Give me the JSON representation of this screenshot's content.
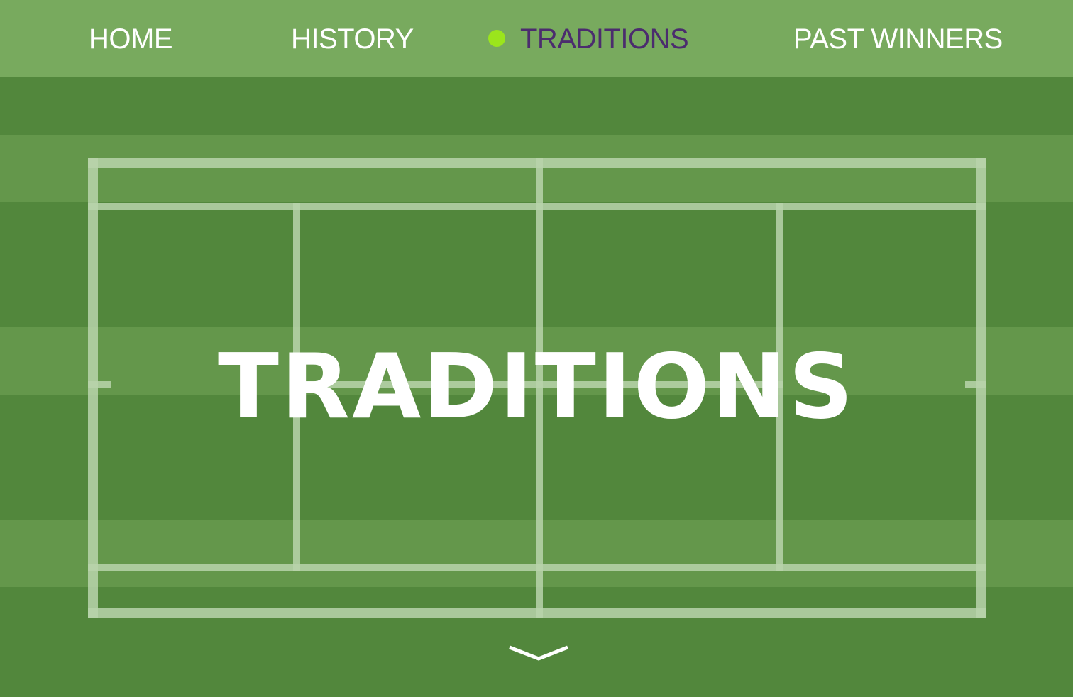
{
  "nav": {
    "items": [
      {
        "label": "HOME"
      },
      {
        "label": "HISTORY"
      },
      {
        "label": "TRADITIONS",
        "active": true
      },
      {
        "label": "PAST WINNERS"
      }
    ]
  },
  "hero": {
    "title": "TRADITIONS"
  },
  "icons": {
    "active_indicator": "dot-icon",
    "scroll": "chevron-down-icon"
  },
  "colors": {
    "nav_background": "#78aa5e",
    "active_text": "#4b2c6e",
    "active_dot": "#9be51c",
    "lawn_dark": "#52873c",
    "lawn_light": "#64974b",
    "court_lines": "#b9d3ab"
  }
}
